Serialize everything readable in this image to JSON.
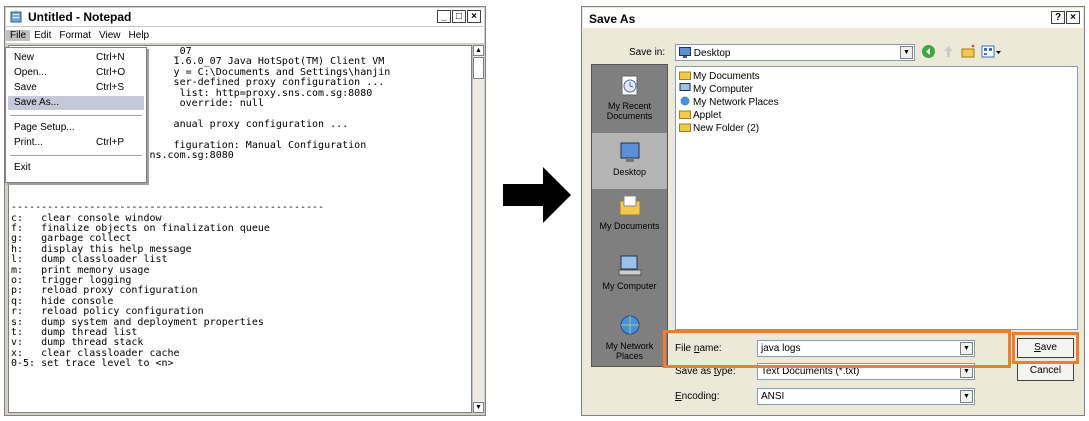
{
  "notepad": {
    "title": "Untitled - Notepad",
    "menu": [
      "File",
      "Edit",
      "Format",
      "View",
      "Help"
    ],
    "file_menu": [
      {
        "label": "New",
        "shortcut": "Ctrl+N"
      },
      {
        "label": "Open...",
        "shortcut": "Ctrl+O"
      },
      {
        "label": "Save",
        "shortcut": "Ctrl+S"
      },
      {
        "label": "Save As...",
        "shortcut": ""
      },
      {
        "label": "Page Setup...",
        "shortcut": ""
      },
      {
        "label": "Print...",
        "shortcut": "Ctrl+P"
      },
      {
        "label": "Exit",
        "shortcut": ""
      }
    ],
    "text": "                           _07\n                           1.6.0_07 Java HotSpot(TM) Client VM\n                           y = C:\\Documents and Settings\\hanjin\n                           ser-defined proxy configuration ...\n                            list: http=proxy.sns.com.sg:8080\n                            override: null\n\n                           anual proxy configuration ...\n\n                           figuration: Manual Configuration\n    Proxy: http=proxy.sns.com.sg:8080\n    Proxy Overrides:\n\n\n\n----------------------------------------------------\nc:   clear console window\nf:   finalize objects on finalization queue\ng:   garbage collect\nh:   display this help message\nl:   dump classloader list\nm:   print memory usage\no:   trigger logging\np:   reload proxy configuration\nq:   hide console\nr:   reload policy configuration\ns:   dump system and deployment properties\nt:   dump thread list\nv:   dump thread stack\nx:   clear classloader cache\n0-5: set trace level to <n>"
  },
  "dialog": {
    "title": "Save As",
    "help": "?",
    "close": "×",
    "save_in_label": "Save in:",
    "save_in_value": "Desktop",
    "places": [
      "My Recent Documents",
      "Desktop",
      "My Documents",
      "My Computer",
      "My Network Places"
    ],
    "files": [
      "My Documents",
      "My Computer",
      "My Network Places",
      "Applet",
      "New Folder (2)"
    ],
    "file_name_label": "File name:",
    "file_name_value": "java logs",
    "save_as_type_label": "Save as type:",
    "save_as_type_value": "Text Documents (*.txt)",
    "encoding_label": "Encoding:",
    "encoding_value": "ANSI",
    "save_button": "Save",
    "cancel_button": "Cancel"
  },
  "colors": {
    "highlight": "#ed7d31",
    "arrow": "#000000"
  }
}
